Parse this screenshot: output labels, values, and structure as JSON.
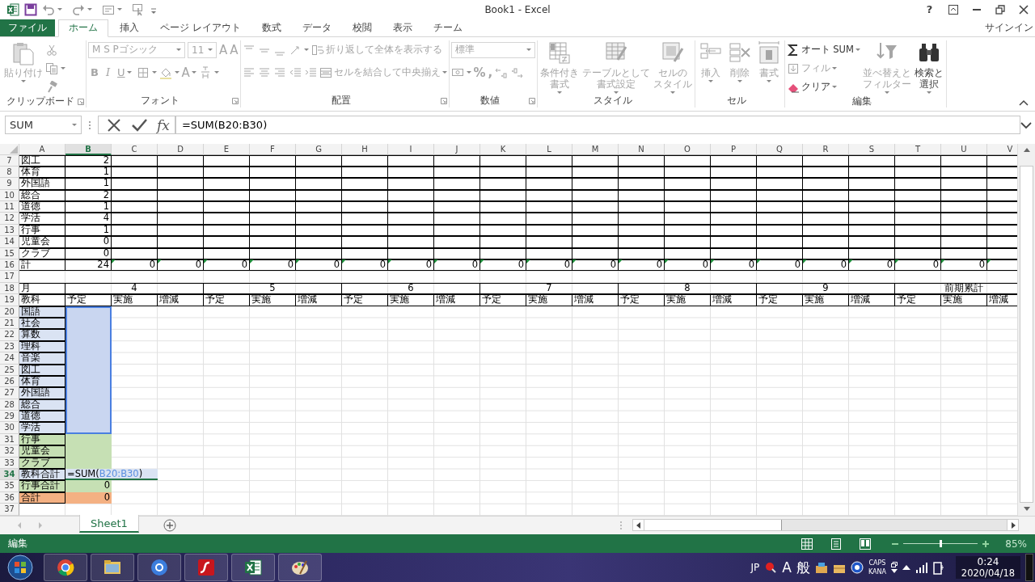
{
  "window": {
    "title": "Book1 - Excel",
    "help": "?"
  },
  "tabs": [
    {
      "label": "ファイル",
      "kind": "file",
      "selected": false
    },
    {
      "label": "ホーム",
      "kind": "tab",
      "selected": true
    },
    {
      "label": "挿入",
      "kind": "tab",
      "selected": false
    },
    {
      "label": "ページ レイアウト",
      "kind": "tab",
      "selected": false
    },
    {
      "label": "数式",
      "kind": "tab",
      "selected": false
    },
    {
      "label": "データ",
      "kind": "tab",
      "selected": false
    },
    {
      "label": "校閲",
      "kind": "tab",
      "selected": false
    },
    {
      "label": "表示",
      "kind": "tab",
      "selected": false
    },
    {
      "label": "チーム",
      "kind": "tab",
      "selected": false
    }
  ],
  "sign_in": "サインイン",
  "ribbon": {
    "groups": [
      {
        "label": "クリップボード",
        "launcher": true,
        "parts": [
          {
            "kind": "large",
            "items": [
              {
                "kind": "paste",
                "lines": [
                  "貼り付け"
                ],
                "disabled": true
              }
            ]
          },
          {
            "kind": "stack",
            "lines": [
              [
                {
                  "kind": "cut",
                  "disabled": true
                }
              ],
              [
                {
                  "kind": "copy",
                  "disabled": true
                }
              ],
              [
                {
                  "kind": "painter",
                  "disabled": true
                }
              ]
            ]
          }
        ]
      },
      {
        "label": "フォント",
        "launcher": true,
        "parts": [
          {
            "kind": "stack",
            "lines": [
              [
                {
                  "kind": "font_field",
                  "value": "M S Pゴシック",
                  "disabled": true
                },
                {
                  "kind": "size_field",
                  "value": "11",
                  "disabled": true
                },
                {
                  "kind": "grow",
                  "label": "A",
                  "disabled": true
                },
                {
                  "kind": "shrink",
                  "label": "A",
                  "disabled": true
                }
              ],
              [
                {
                  "kind": "bold",
                  "label": "B",
                  "disabled": true
                },
                {
                  "kind": "italic",
                  "label": "I",
                  "disabled": true
                },
                {
                  "kind": "underline",
                  "label": "U",
                  "disabled": true
                },
                {
                  "kind": "border",
                  "disabled": true
                },
                {
                  "kind": "fill",
                  "disabled": true
                },
                {
                  "kind": "font_color",
                  "label": "A",
                  "disabled": true
                },
                {
                  "kind": "phonetic",
                  "disabled": true
                }
              ]
            ]
          }
        ]
      },
      {
        "label": "配置",
        "launcher": true,
        "parts": [
          {
            "kind": "stack",
            "lines": [
              [
                {
                  "kind": "align_top",
                  "disabled": true
                },
                {
                  "kind": "align_middle",
                  "disabled": true
                },
                {
                  "kind": "align_bottom",
                  "disabled": true
                },
                {
                  "kind": "orientation",
                  "disabled": true
                },
                {
                  "kind": "wrap",
                  "label": "折り返して全体を表示する",
                  "disabled": true
                }
              ],
              [
                {
                  "kind": "align_left",
                  "disabled": true
                },
                {
                  "kind": "align_center",
                  "disabled": true
                },
                {
                  "kind": "align_right",
                  "disabled": true
                },
                {
                  "kind": "indent_less",
                  "disabled": true
                },
                {
                  "kind": "indent_more",
                  "disabled": true
                },
                {
                  "kind": "merge",
                  "label": "セルを結合して中央揃え",
                  "disabled": true
                }
              ]
            ]
          }
        ]
      },
      {
        "label": "数値",
        "launcher": true,
        "parts": [
          {
            "kind": "stack",
            "lines": [
              [
                {
                  "kind": "format_field",
                  "value": "標準",
                  "disabled": true
                }
              ],
              [
                {
                  "kind": "currency",
                  "disabled": true
                },
                {
                  "kind": "percent",
                  "label": "%",
                  "disabled": true
                },
                {
                  "kind": "comma",
                  "label": ",",
                  "disabled": true
                },
                {
                  "kind": "dec_more",
                  "disabled": true
                },
                {
                  "kind": "dec_less",
                  "disabled": true
                }
              ]
            ]
          }
        ]
      },
      {
        "label": "スタイル",
        "launcher": false,
        "parts": [
          {
            "kind": "large",
            "items": [
              {
                "kind": "cond_format",
                "lines": [
                  "条件付き",
                  "書式"
                ],
                "disabled": true
              },
              {
                "kind": "table_format",
                "lines": [
                  "テーブルとして",
                  "書式設定"
                ],
                "disabled": true
              },
              {
                "kind": "cell_style",
                "lines": [
                  "セルの",
                  "スタイル"
                ],
                "disabled": true
              }
            ]
          }
        ]
      },
      {
        "label": "セル",
        "launcher": false,
        "parts": [
          {
            "kind": "large",
            "items": [
              {
                "kind": "insert",
                "lines": [
                  "挿入"
                ],
                "disabled": true
              },
              {
                "kind": "delete",
                "lines": [
                  "削除"
                ],
                "disabled": true
              },
              {
                "kind": "format",
                "lines": [
                  "書式"
                ],
                "disabled": true
              }
            ]
          }
        ]
      },
      {
        "label": "編集",
        "launcher": false,
        "parts": [
          {
            "kind": "stack",
            "lines": [
              [
                {
                  "kind": "autosum",
                  "label": "オート SUM",
                  "disabled": false
                }
              ],
              [
                {
                  "kind": "fill_down",
                  "label": "フィル",
                  "disabled": true
                }
              ],
              [
                {
                  "kind": "clear",
                  "label": "クリア",
                  "disabled": false
                }
              ]
            ]
          },
          {
            "kind": "large",
            "items": [
              {
                "kind": "sort",
                "lines": [
                  "並べ替えと",
                  "フィルター"
                ],
                "disabled": true
              },
              {
                "kind": "find",
                "lines": [
                  "検索と",
                  "選択"
                ],
                "disabled": false
              }
            ]
          }
        ]
      }
    ]
  },
  "formula_bar": {
    "name_box": "SUM",
    "fx": "fx",
    "formula": "=SUM(B20:B30)"
  },
  "sheet": {
    "columns": [
      {
        "text": "A",
        "selected": false
      },
      {
        "text": "B",
        "selected": true
      },
      {
        "text": "C",
        "selected": false
      },
      {
        "text": "D",
        "selected": false
      },
      {
        "text": "E",
        "selected": false
      },
      {
        "text": "F",
        "selected": false
      },
      {
        "text": "G",
        "selected": false
      },
      {
        "text": "H",
        "selected": false
      },
      {
        "text": "I",
        "selected": false
      },
      {
        "text": "J",
        "selected": false
      },
      {
        "text": "K",
        "selected": false
      },
      {
        "text": "L",
        "selected": false
      },
      {
        "text": "M",
        "selected": false
      },
      {
        "text": "N",
        "selected": false
      },
      {
        "text": "O",
        "selected": false
      },
      {
        "text": "P",
        "selected": false
      },
      {
        "text": "Q",
        "selected": false
      },
      {
        "text": "R",
        "selected": false
      },
      {
        "text": "S",
        "selected": false
      },
      {
        "text": "T",
        "selected": false
      },
      {
        "text": "U",
        "selected": false
      },
      {
        "text": "V",
        "selected": false
      }
    ],
    "rows": [
      {
        "header": "7",
        "selected": false,
        "kind": "bordered",
        "cells": [
          {
            "text": "図工"
          },
          {
            "text": "2"
          }
        ]
      },
      {
        "header": "8",
        "selected": false,
        "kind": "bordered",
        "cells": [
          {
            "text": "体育"
          },
          {
            "text": "1"
          }
        ]
      },
      {
        "header": "9",
        "selected": false,
        "kind": "bordered",
        "cells": [
          {
            "text": "外国語"
          },
          {
            "text": "1"
          }
        ]
      },
      {
        "header": "10",
        "selected": false,
        "kind": "bordered",
        "cells": [
          {
            "text": "総合"
          },
          {
            "text": "2"
          }
        ]
      },
      {
        "header": "11",
        "selected": false,
        "kind": "bordered",
        "cells": [
          {
            "text": "道徳"
          },
          {
            "text": "1"
          }
        ]
      },
      {
        "header": "12",
        "selected": false,
        "kind": "bordered",
        "cells": [
          {
            "text": "学活"
          },
          {
            "text": "4"
          }
        ]
      },
      {
        "header": "13",
        "selected": false,
        "kind": "bordered",
        "cells": [
          {
            "text": "行事"
          },
          {
            "text": "1"
          }
        ]
      },
      {
        "header": "14",
        "selected": false,
        "kind": "bordered",
        "cells": [
          {
            "text": "児童会"
          },
          {
            "text": "0"
          }
        ]
      },
      {
        "header": "15",
        "selected": false,
        "kind": "bordered",
        "cells": [
          {
            "text": "クラブ"
          },
          {
            "text": "0"
          }
        ]
      },
      {
        "header": "16",
        "selected": false,
        "kind": "bordered",
        "cells": [
          {
            "text": "計",
            "flag": false
          },
          {
            "text": "24",
            "flag": false
          },
          {
            "text": "0",
            "flag": true
          },
          {
            "text": "0",
            "flag": true
          },
          {
            "text": "0",
            "flag": true
          },
          {
            "text": "0",
            "flag": true
          },
          {
            "text": "0",
            "flag": true
          },
          {
            "text": "0",
            "flag": true
          },
          {
            "text": "0",
            "flag": true
          },
          {
            "text": "0",
            "flag": true
          },
          {
            "text": "0",
            "flag": true
          },
          {
            "text": "0",
            "flag": true
          },
          {
            "text": "0",
            "flag": true
          },
          {
            "text": "0",
            "flag": true
          },
          {
            "text": "0",
            "flag": true
          },
          {
            "text": "0",
            "flag": true
          },
          {
            "text": "0",
            "flag": true
          },
          {
            "text": "0",
            "flag": true
          },
          {
            "text": "0",
            "flag": true
          },
          {
            "text": "0",
            "flag": true
          },
          {
            "text": "0",
            "flag": true
          },
          {
            "flag": true
          }
        ]
      },
      {
        "header": "17",
        "selected": false,
        "kind": "blank"
      },
      {
        "header": "18",
        "selected": false,
        "kind": "months",
        "cells": [
          {
            "text": "月"
          },
          {
            "text": "4"
          },
          {
            "text": "5"
          },
          {
            "text": "6"
          },
          {
            "text": "7"
          },
          {
            "text": "8"
          },
          {
            "text": "9"
          },
          {
            "text": "前期累計"
          }
        ]
      },
      {
        "header": "19",
        "selected": false,
        "kind": "labels",
        "cells": [
          {
            "text": "教科"
          },
          {
            "text": "予定"
          },
          {
            "text": "実施"
          },
          {
            "text": "増減"
          },
          {
            "text": "予定"
          },
          {
            "text": "実施"
          },
          {
            "text": "増減"
          },
          {
            "text": "予定"
          },
          {
            "text": "実施"
          },
          {
            "text": "増減"
          },
          {
            "text": "予定"
          },
          {
            "text": "実施"
          },
          {
            "text": "増減"
          },
          {
            "text": "予定"
          },
          {
            "text": "実施"
          },
          {
            "text": "増減"
          },
          {
            "text": "予定"
          },
          {
            "text": "実施"
          },
          {
            "text": "増減"
          },
          {
            "text": "予定"
          },
          {
            "text": "実施"
          },
          {
            "text": "増減"
          }
        ]
      },
      {
        "header": "20",
        "selected": false,
        "kind": "list",
        "cells": [
          {
            "text": "国語",
            "color": "#dae3f3"
          },
          {
            "kind": "ref",
            "color": "#c9d6f0"
          }
        ]
      },
      {
        "header": "21",
        "selected": false,
        "kind": "list",
        "cells": [
          {
            "text": "社会",
            "color": "#dae3f3"
          },
          {
            "kind": "ref",
            "color": "#c9d6f0"
          }
        ]
      },
      {
        "header": "22",
        "selected": false,
        "kind": "list",
        "cells": [
          {
            "text": "算数",
            "color": "#dae3f3"
          },
          {
            "kind": "ref",
            "color": "#c9d6f0"
          }
        ]
      },
      {
        "header": "23",
        "selected": false,
        "kind": "list",
        "cells": [
          {
            "text": "理科",
            "color": "#dae3f3"
          },
          {
            "kind": "ref",
            "color": "#c9d6f0"
          }
        ]
      },
      {
        "header": "24",
        "selected": false,
        "kind": "list",
        "cells": [
          {
            "text": "音楽",
            "color": "#dae3f3"
          },
          {
            "kind": "ref",
            "color": "#c9d6f0"
          }
        ]
      },
      {
        "header": "25",
        "selected": false,
        "kind": "list",
        "cells": [
          {
            "text": "図工",
            "color": "#dae3f3"
          },
          {
            "kind": "ref",
            "color": "#c9d6f0"
          }
        ]
      },
      {
        "header": "26",
        "selected": false,
        "kind": "list",
        "cells": [
          {
            "text": "体育",
            "color": "#dae3f3"
          },
          {
            "kind": "ref",
            "color": "#c9d6f0"
          }
        ]
      },
      {
        "header": "27",
        "selected": false,
        "kind": "list",
        "cells": [
          {
            "text": "外国語",
            "color": "#dae3f3"
          },
          {
            "kind": "ref",
            "color": "#c9d6f0"
          }
        ]
      },
      {
        "header": "28",
        "selected": false,
        "kind": "list",
        "cells": [
          {
            "text": "総合",
            "color": "#dae3f3"
          },
          {
            "kind": "ref",
            "color": "#c9d6f0"
          }
        ]
      },
      {
        "header": "29",
        "selected": false,
        "kind": "list",
        "cells": [
          {
            "text": "道徳",
            "color": "#dae3f3"
          },
          {
            "kind": "ref",
            "color": "#c9d6f0"
          }
        ]
      },
      {
        "header": "30",
        "selected": false,
        "kind": "list",
        "cells": [
          {
            "text": "学活",
            "color": "#dae3f3"
          },
          {
            "kind": "ref",
            "color": "#c9d6f0"
          }
        ]
      },
      {
        "header": "31",
        "selected": false,
        "kind": "list",
        "cells": [
          {
            "text": "行事",
            "color": "#c6e0b4"
          },
          {
            "color": "#c6e0b4"
          }
        ]
      },
      {
        "header": "32",
        "selected": false,
        "kind": "list",
        "cells": [
          {
            "text": "児童会",
            "color": "#c6e0b4"
          },
          {
            "color": "#c6e0b4"
          }
        ]
      },
      {
        "header": "33",
        "selected": false,
        "kind": "list",
        "cells": [
          {
            "text": "クラブ",
            "color": "#c6e0b4"
          },
          {
            "color": "#c6e0b4"
          }
        ]
      },
      {
        "header": "34",
        "selected": true,
        "kind": "list",
        "cells": [
          {
            "text": "教科合計",
            "color": "#dae3f3"
          },
          {
            "kind": "editing",
            "parts": [
              {
                "text": "=SUM("
              },
              {
                "text": "B20:B30",
                "color": "#5b8fe0"
              },
              {
                "text": ")"
              }
            ]
          }
        ]
      },
      {
        "header": "35",
        "selected": false,
        "kind": "list",
        "cells": [
          {
            "text": "行事合計",
            "color": "#c6e0b4"
          },
          {
            "text": "0",
            "color": "#c6e0b4"
          }
        ]
      },
      {
        "header": "36",
        "selected": false,
        "kind": "list",
        "cells": [
          {
            "text": "合計",
            "color": "#f4b183"
          },
          {
            "text": "0",
            "color": "#f4b183"
          }
        ]
      },
      {
        "header": "37",
        "selected": false,
        "kind": "blank"
      }
    ]
  },
  "sheet_tabs": [
    {
      "label": "Sheet1",
      "selected": true
    }
  ],
  "status_bar": {
    "mode": "編集",
    "zoom": {
      "level": 0.5,
      "reading": "85%"
    }
  },
  "taskbar": {
    "language": "JP",
    "ime_mode": "A",
    "ime_dict": "般",
    "caps": "CAPS",
    "kana": "KANA",
    "time": "0:24",
    "date": "2020/04/18"
  }
}
